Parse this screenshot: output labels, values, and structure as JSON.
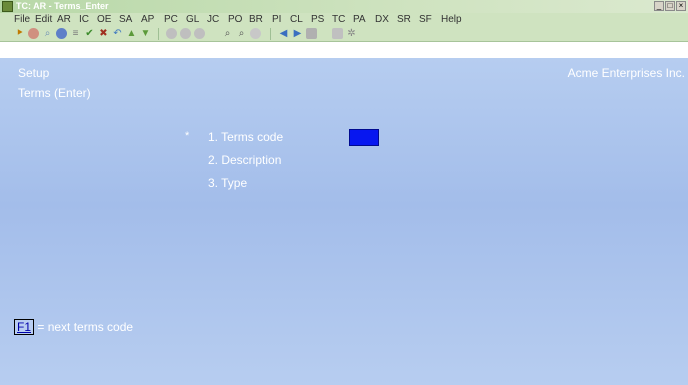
{
  "window": {
    "title": "TC: AR - Terms_Enter",
    "minimize": "_",
    "maximize": "□",
    "close": "×"
  },
  "menu": [
    "File",
    "Edit",
    "AR",
    "IC",
    "OE",
    "SA",
    "AP",
    "PC",
    "GL",
    "JC",
    "PO",
    "BR",
    "PI",
    "CL",
    "PS",
    "TC",
    "PA",
    "DX",
    "SR",
    "SF",
    "Help"
  ],
  "toolbar": {
    "icons": [
      "open-icon",
      "record-icon",
      "search-icon",
      "globe-icon",
      "print-icon",
      "check-icon",
      "delete-icon",
      "undo-icon",
      "up-arrow-icon",
      "down-arrow-icon",
      "refresh-icon",
      "refresh2-icon",
      "refresh3-icon",
      "find-icon",
      "zoom-icon",
      "reload-icon",
      "prev-icon",
      "next-icon",
      "stop-icon",
      "calc-icon",
      "settings-icon"
    ]
  },
  "header": {
    "section": "Setup",
    "screen_title": "Terms (Enter)",
    "company": "Acme Enterprises Inc."
  },
  "form": {
    "required_marker": "*",
    "fields": [
      {
        "label": "1. Terms code"
      },
      {
        "label": "2. Description"
      },
      {
        "label": "3. Type"
      }
    ]
  },
  "hint": {
    "key": "F1",
    "text": "= next terms code"
  }
}
